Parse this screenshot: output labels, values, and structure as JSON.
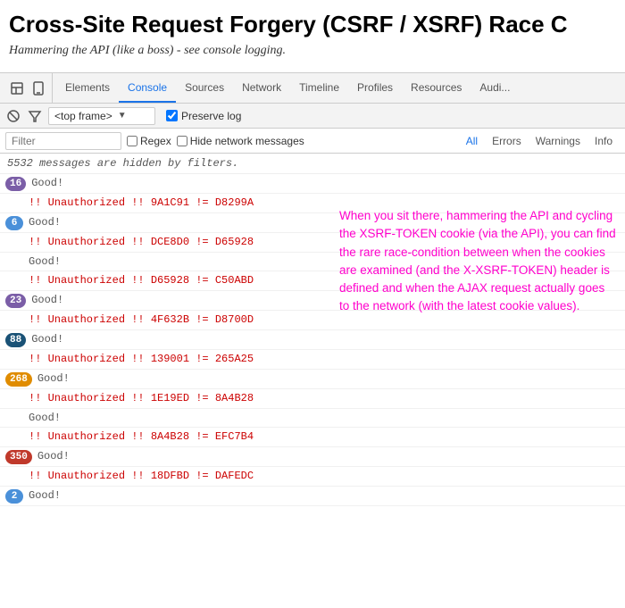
{
  "page": {
    "title": "Cross-Site Request Forgery (CSRF / XSRF) Race C",
    "subtitle": "Hammering the API (like a boss) - see console logging."
  },
  "devtools": {
    "tabs": [
      {
        "id": "elements",
        "label": "Elements",
        "active": false
      },
      {
        "id": "console",
        "label": "Console",
        "active": true
      },
      {
        "id": "sources",
        "label": "Sources",
        "active": false
      },
      {
        "id": "network",
        "label": "Network",
        "active": false
      },
      {
        "id": "timeline",
        "label": "Timeline",
        "active": false
      },
      {
        "id": "profiles",
        "label": "Profiles",
        "active": false
      },
      {
        "id": "resources",
        "label": "Resources",
        "active": false
      },
      {
        "id": "audits",
        "label": "Audi...",
        "active": false
      }
    ],
    "toolbar": {
      "frame": "<top frame>",
      "preserve_log_label": "Preserve log"
    },
    "filter_bar": {
      "placeholder": "Filter",
      "regex_label": "Regex",
      "hide_network_label": "Hide network messages",
      "all_label": "All",
      "errors_label": "Errors",
      "warnings_label": "Warnings",
      "info_label": "Info"
    },
    "console": {
      "filter_msg": "5532 messages are hidden by filters.",
      "rows": [
        {
          "badge": "16",
          "badge_color": "purple",
          "texts": [
            "Good!",
            "!! Unauthorized !! 9A1C91 != D8299A"
          ]
        },
        {
          "badge": "6",
          "badge_color": "blue",
          "texts": [
            "Good!",
            "!! Unauthorized !! DCE8D0 != D65928"
          ]
        },
        {
          "badge": null,
          "texts": [
            "Good!",
            "!! Unauthorized !! D65928 != C50ABD"
          ]
        },
        {
          "badge": "23",
          "badge_color": "purple",
          "texts": [
            "Good!",
            "!! Unauthorized !! 4F632B != D8700D"
          ]
        },
        {
          "badge": "88",
          "badge_color": "dark-blue",
          "texts": [
            "Good!",
            "!! Unauthorized !! 139001 != 265A25"
          ]
        },
        {
          "badge": "268",
          "badge_color": "orange",
          "texts": [
            "Good!",
            "!! Unauthorized !! 1E19ED != 8A4B28"
          ]
        },
        {
          "badge": null,
          "texts": [
            "Good!",
            "!! Unauthorized !! 8A4B28 != EFC7B4"
          ]
        },
        {
          "badge": "350",
          "badge_color": "red",
          "texts": [
            "Good!",
            "!! Unauthorized !! 18DFBD != DAFEDC"
          ]
        },
        {
          "badge": "2",
          "badge_color": "blue",
          "texts": [
            "Good!"
          ]
        }
      ],
      "annotation": "When you sit there, hammering the API and cycling the XSRF-TOKEN cookie (via the API), you can find the rare race-condition between when the cookies are examined (and the X-XSRF-TOKEN) header is defined and when the AJAX request actually goes to the network (with the latest cookie values)."
    }
  }
}
